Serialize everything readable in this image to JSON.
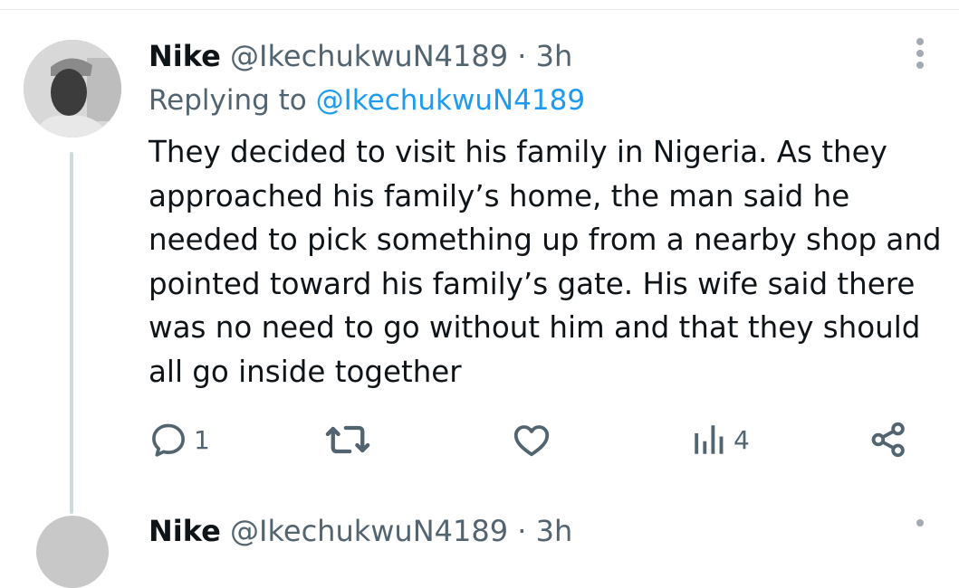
{
  "tweet": {
    "name": "Nike",
    "handle": "@IkechukwuN4189",
    "separator": "·",
    "time": "3h",
    "replying_prefix": "Replying to",
    "replying_to": "@IkechukwuN4189",
    "text_lines": [
      "They decided to visit his family in Nigeria. As they",
      "approached his family’s home, the man said he",
      "needed to pick something up from a nearby shop and",
      "pointed toward his family’s gate. His wife said there",
      "was no need to go without him and that they should",
      "all go inside together"
    ],
    "actions": {
      "reply_count": "1",
      "views_count": "4"
    }
  },
  "next_tweet": {
    "name": "Nike",
    "handle": "@IkechukwuN4189",
    "separator": "·",
    "time": "3h"
  },
  "icons": [
    "more-icon",
    "reply-icon",
    "retweet-icon",
    "like-icon",
    "views-icon",
    "share-icon"
  ],
  "colors": {
    "link": "#1d9bf0",
    "secondary": "#536471",
    "text": "#0f1419",
    "thread_line": "#cfd9de"
  }
}
